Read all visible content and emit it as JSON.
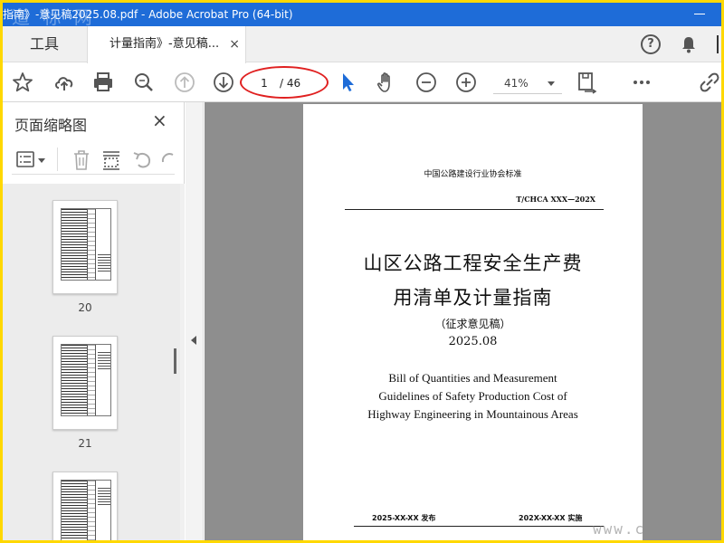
{
  "window": {
    "title": "指南》-意见稿2025.08.pdf - Adobe Acrobat Pro (64-bit)",
    "watermark_top": "道 标 网",
    "watermark_bottom": "www.c"
  },
  "tabs": {
    "tools": "工具",
    "document": "计量指南》-意见稿...",
    "close": "×"
  },
  "toolbar": {
    "page_current": "1",
    "page_total": "/ 46",
    "zoom": "41%"
  },
  "sidebar": {
    "title": "页面缩略图",
    "close": "×",
    "thumbnails": [
      {
        "label": "20"
      },
      {
        "label": "21"
      },
      {
        "label": ""
      }
    ]
  },
  "document": {
    "org": "中国公路建设行业协会标准",
    "code": "T/CHCA XXX—202X",
    "title_line1": "山区公路工程安全生产费",
    "title_line2": "用清单及计量指南",
    "subtitle": "（征求意见稿）",
    "date": "2025.08",
    "english_line1": "Bill of Quantities and Measurement",
    "english_line2": "Guidelines of Safety Production Cost of",
    "english_line3": "Highway Engineering in Mountainous Areas",
    "footer_publish": "2025-XX-XX 发布",
    "footer_implement": "202X-XX-XX 实施"
  },
  "colors": {
    "titlebar": "#1e6cd8",
    "border": "#ffd800",
    "highlight_ellipse": "#e02020",
    "select_cursor": "#1e6cd8"
  }
}
